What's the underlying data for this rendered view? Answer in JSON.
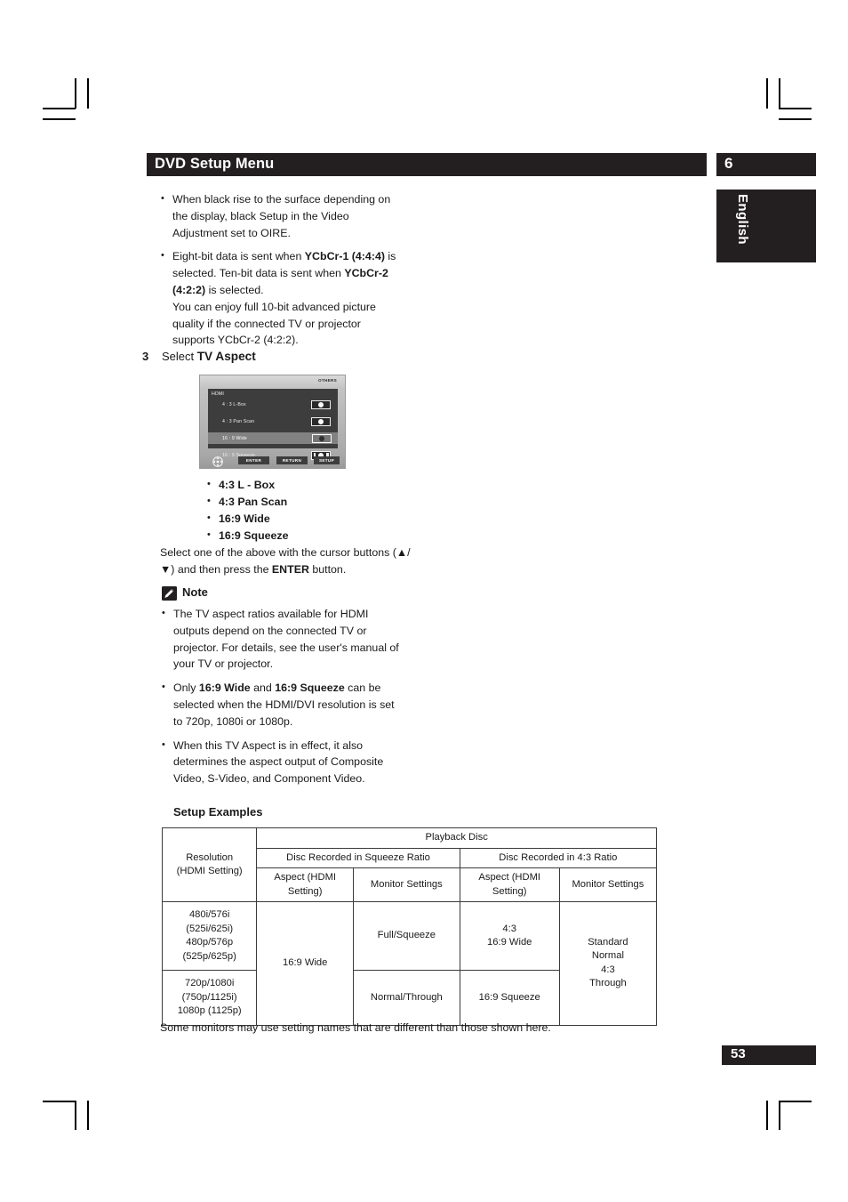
{
  "header": {
    "title": "DVD Setup Menu",
    "chapter": "6",
    "language_tab": "English"
  },
  "intro_bullets": [
    {
      "id": "black-rise",
      "html": "When black rise to the surface depending on the display, black Setup in the Video Adjustment set to OIRE."
    },
    {
      "id": "eight-bit-data",
      "html": "Eight-bit data is sent when <b>YCbCr-1 (4:4:4)</b> is selected. Ten-bit data is sent when <b>YCbCr-2 (4:2:2)</b> is selected.<br>You can enjoy full 10-bit advanced picture quality if the connected TV or projector supports YCbCr-2 (4:2:2)."
    }
  ],
  "step": {
    "number": "3",
    "prefix": "Select ",
    "bold": "TV Aspect"
  },
  "osd": {
    "others_label": "OTHERS",
    "hdmi_label": "HDMI",
    "rows": [
      {
        "label": "4 : 3 L-Box",
        "selected": false,
        "style": "dot"
      },
      {
        "label": "4 : 3 Pan Scan",
        "selected": false,
        "style": "dot"
      },
      {
        "label": "16 : 9 Wide",
        "selected": true,
        "style": "dot"
      },
      {
        "label": "16 : 9 Squeeze",
        "selected": false,
        "style": "squeeze"
      }
    ],
    "keys": [
      "ENTER",
      "RETURN",
      "SETUP"
    ]
  },
  "aspect_options": [
    "4:3 L - Box",
    "4:3 Pan Scan",
    "16:9 Wide",
    "16:9 Squeeze"
  ],
  "select_paragraph": {
    "html": "Select one of the above with the cursor buttons (▲/▼) and then press the <b>ENTER</b> button."
  },
  "note": {
    "label": "Note",
    "icon": "pencil-icon",
    "bullets": [
      {
        "id": "aspect-ratios-hdmi",
        "html": "The TV aspect ratios available for HDMI outputs depend on the connected TV or projector. For details, see the user's manual of your TV or projector."
      },
      {
        "id": "only-wide-squeeze",
        "html": "Only <b>16:9 Wide</b> and <b>16:9 Squeeze</b> can be selected when the HDMI/DVI resolution is set to 720p, 1080i or 1080p."
      },
      {
        "id": "tv-aspect-effect",
        "html": "When this TV Aspect is in effect, it also determines the aspect output of Composite Video, S-Video, and Component Video."
      }
    ]
  },
  "setup_examples": {
    "title": "Setup Examples",
    "headers": {
      "resolution": "Resolution\n(HDMI Setting)",
      "playback_disc": "Playback Disc",
      "squeeze_group": "Disc Recorded in Squeeze Ratio",
      "four_three_group": "Disc Recorded in 4:3 Ratio",
      "aspect_hdmi_1": "Aspect (HDMI Setting)",
      "monitor_settings_1": "Monitor Settings",
      "aspect_hdmi_2": "Aspect (HDMI Setting)",
      "monitor_settings_2": "Monitor Settings"
    },
    "rows": [
      {
        "resolution": "480i/576i\n(525i/625i)\n480p/576p\n(525p/625p)",
        "aspect_squeeze": "16:9  Wide",
        "monitor_squeeze": "Full/Squeeze",
        "aspect_43": "4:3\n16:9 Wide",
        "monitor_43": "Standard\nNormal\n4:3\nThrough"
      },
      {
        "resolution": "720p/1080i\n(750p/1125i)\n1080p (1125p)",
        "monitor_squeeze": "Normal/Through",
        "aspect_43": "16:9 Squeeze"
      }
    ]
  },
  "bottom_note": "Some monitors may use setting names that are different than those shown here.",
  "page_number": "53",
  "colors": {
    "ink": "#231f20",
    "paper": "#ffffff"
  }
}
